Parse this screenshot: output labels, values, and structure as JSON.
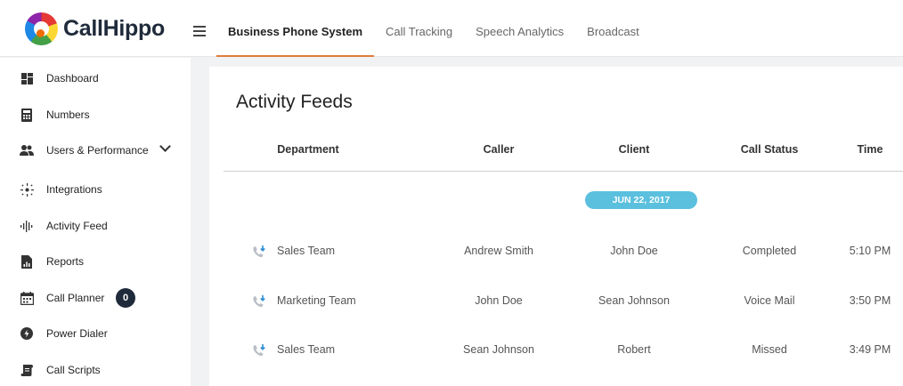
{
  "app": {
    "name": "CallHippo"
  },
  "header": {
    "tabs": [
      {
        "label": "Business Phone System",
        "active": true
      },
      {
        "label": "Call Tracking",
        "active": false
      },
      {
        "label": "Speech Analytics",
        "active": false
      },
      {
        "label": "Broadcast",
        "active": false
      }
    ]
  },
  "sidebar": {
    "items": [
      {
        "label": "Dashboard",
        "icon": "dashboard-icon"
      },
      {
        "label": "Numbers",
        "icon": "numbers-icon"
      },
      {
        "label": "Users & Performance",
        "icon": "users-icon"
      },
      {
        "label": "Integrations",
        "icon": "integrations-icon"
      },
      {
        "label": "Activity Feed",
        "icon": "activity-feed-icon"
      },
      {
        "label": "Reports",
        "icon": "reports-icon"
      },
      {
        "label": "Call Planner",
        "icon": "call-planner-icon",
        "badge": "0"
      },
      {
        "label": "Power Dialer",
        "icon": "power-dialer-icon"
      },
      {
        "label": "Call Scripts",
        "icon": "call-scripts-icon"
      }
    ]
  },
  "main": {
    "title": "Activity Feeds",
    "columns": [
      "Department",
      "Caller",
      "Client",
      "Call Status",
      "Time"
    ],
    "date_group": "JUN 22, 2017",
    "rows": [
      {
        "department": "Sales Team",
        "caller": "Andrew Smith",
        "client": "John Doe",
        "status": "Completed",
        "time": "5:10 PM"
      },
      {
        "department": "Marketing Team",
        "caller": "John Doe",
        "client": "Sean Johnson",
        "status": "Voice Mail",
        "time": "3:50 PM"
      },
      {
        "department": "Sales Team",
        "caller": "Sean Johnson",
        "client": "Robert",
        "status": "Missed",
        "time": "3:49 PM"
      }
    ]
  },
  "colors": {
    "accent": "#e07c3e",
    "date_pill": "#5bc0de",
    "badge": "#1f2a3a",
    "incoming_call": "#2d8fd6"
  }
}
